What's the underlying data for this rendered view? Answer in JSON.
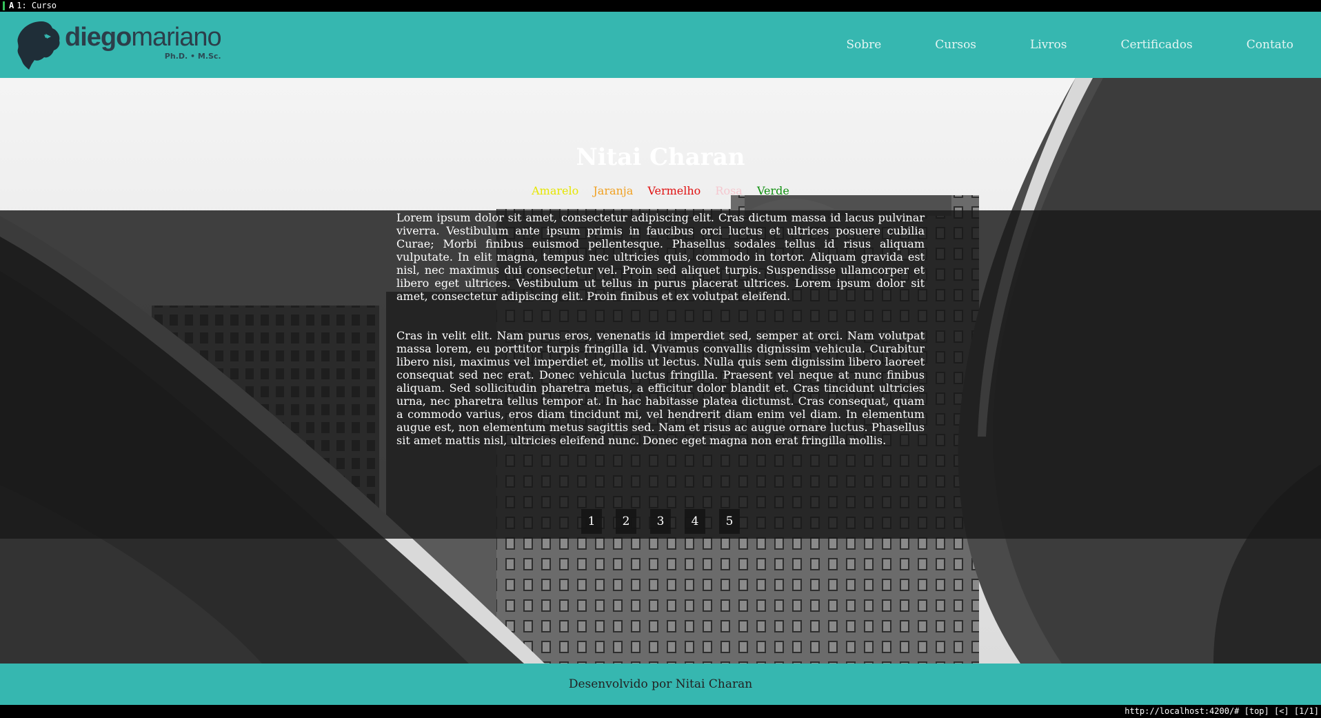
{
  "browser": {
    "tab_label": "1: Curso",
    "status_url": "http://localhost:4200/# [top] [<] [1/1]"
  },
  "header": {
    "logo_bold": "diego",
    "logo_light": "mariano",
    "logo_sub": "Ph.D. • M.Sc.",
    "nav": [
      "Sobre",
      "Cursos",
      "Livros",
      "Certificados",
      "Contato"
    ]
  },
  "main": {
    "title": "Nitai Charan",
    "colors": [
      {
        "label": "Amarelo",
        "color": "#e6e600"
      },
      {
        "label": "Jaranja",
        "color": "#f0a020"
      },
      {
        "label": "Vermelho",
        "color": "#e01010"
      },
      {
        "label": "Rosa",
        "color": "#f5c8d0"
      },
      {
        "label": "Verde",
        "color": "#109010"
      }
    ],
    "paragraph1": "Lorem ipsum dolor sit amet, consectetur adipiscing elit. Cras dictum massa id lacus pulvinar viverra. Vestibulum ante ipsum primis in faucibus orci luctus et ultrices posuere cubilia Curae; Morbi finibus euismod pellentesque. Phasellus sodales tellus id risus aliquam vulputate. In elit magna, tempus nec ultricies quis, commodo in tortor. Aliquam gravida est nisl, nec maximus dui consectetur vel. Proin sed aliquet turpis. Suspendisse ullamcorper et libero eget ultrices. Vestibulum ut tellus in purus placerat ultrices. Lorem ipsum dolor sit amet, consectetur adipiscing elit. Proin finibus et ex volutpat eleifend.",
    "paragraph2": "Cras in velit elit. Nam purus eros, venenatis id imperdiet sed, semper at orci. Nam volutpat massa lorem, eu porttitor turpis fringilla id. Vivamus convallis dignissim vehicula. Curabitur libero nisi, maximus vel imperdiet et, mollis ut lectus. Nulla quis sem dignissim libero laoreet consequat sed nec erat. Donec vehicula luctus fringilla. Praesent vel neque at nunc finibus aliquam. Sed sollicitudin pharetra metus, a efficitur dolor blandit et. Cras tincidunt ultricies urna, nec pharetra tellus tempor at. In hac habitasse platea dictumst. Cras consequat, quam a commodo varius, eros diam tincidunt mi, vel hendrerit diam enim vel diam. In elementum augue est, non elementum metus sagittis sed. Nam et risus ac augue ornare luctus. Phasellus sit amet mattis nisl, ultricies eleifend nunc. Donec eget magna non erat fringilla mollis.",
    "pages": [
      "1",
      "2",
      "3",
      "4",
      "5"
    ]
  },
  "footer": {
    "text": "Desenvolvido por Nitai Charan"
  },
  "theme": {
    "header_bg": "#36b7b0",
    "footer_bg": "#36b7b0",
    "overlay": "rgba(24,24,24,0.82)"
  }
}
